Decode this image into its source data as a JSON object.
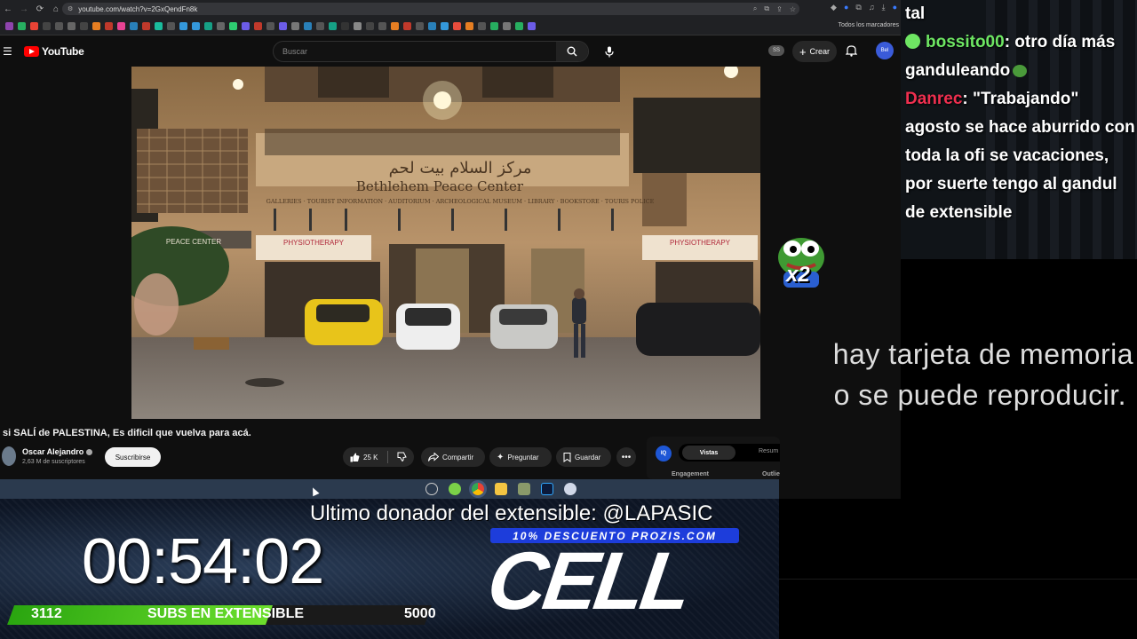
{
  "browser": {
    "url": "youtube.com/watch?v=2GxQendFn8k",
    "all_bookmarks": "Todos los marcadores"
  },
  "youtube": {
    "logo_text": "YouTube",
    "search_placeholder": "Buscar",
    "ss_badge": "SS",
    "create_label": "Crear",
    "avatar_text": "Bel"
  },
  "video": {
    "building_arabic": "مركز السلام بيت لحم",
    "building_name": "Bethlehem Peace Center",
    "building_subline": "GALLERIES · TOURIST INFORMATION · AUDITORIUM · ARCHEOLOGICAL MUSEUM · LIBRARY · BOOKSTORE · TOURIS POLICE",
    "sign_left": "PEACE CENTER",
    "sign_physio_1": "PHYSIOTHERAPY",
    "sign_physio_2": "PHYSIOTHERAPY",
    "title": "si SALÍ de PALESTINA, Es dificil que vuelva para acá.",
    "channel_name": "Oscar Alejandro",
    "channel_subs": "2,63 M de suscriptores",
    "subscribe_label": "Suscribirse",
    "likes": "25 K",
    "share_label": "Compartir",
    "ask_label": "Preguntar",
    "save_label": "Guardar"
  },
  "vidiq": {
    "logo": "IQ",
    "tab_active": "Vistas",
    "tab_other": "Resum",
    "engagement": "Engagement",
    "outlier": "Outlie"
  },
  "chat": {
    "line0": "tal",
    "msg1_user": "bossito00",
    "msg1_text": ": otro día más ganduleando",
    "msg2_user": "Danrec",
    "msg2_text": ": \"Trabajando\" agosto se hace aburrido con toda la ofi se vacaciones, por suerte tengo al gandul de extensible"
  },
  "emote": {
    "multiplier": "x2"
  },
  "subtitles": {
    "line1": "hay tarjeta de memoria",
    "line2": "o se puede reproducir."
  },
  "overlay": {
    "donor": "Ultimo donador del extensible: @LAPASIC",
    "timer": "00:54:02",
    "promo": "10% DESCUENTO PROZIS.COM",
    "sponsor_logo": "CELL",
    "subs_current": "3112",
    "subs_label": "SUBS EN EXTENSIBLE",
    "subs_goal": "5000",
    "subs_progress": 0.62
  },
  "colors": {
    "yt_red": "#ff0000",
    "chat_green": "#6ee663",
    "chat_red": "#ef2f4f",
    "promo_blue": "#1d3ddb",
    "subs_green": "#4cc41e"
  }
}
